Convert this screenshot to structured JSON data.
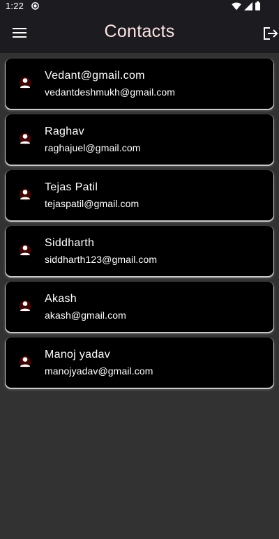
{
  "status_bar": {
    "time": "1:22",
    "icons": [
      "sync-circle-icon",
      "wifi-icon",
      "signal-icon",
      "battery-icon"
    ]
  },
  "app_bar": {
    "title": "Contacts",
    "left_icon": "menu-icon",
    "right_icon": "logout-icon"
  },
  "colors": {
    "background": "#323233",
    "app_bar": "#1c1b1f",
    "title": "#fde4e4",
    "card": "#000000",
    "avatar_glow": "#8b0a0a"
  },
  "contacts": [
    {
      "name": "Vedant@gmail.com",
      "email": "vedantdeshmukh@gmail.com",
      "icon": "person-icon"
    },
    {
      "name": "Raghav",
      "email": "raghajuel@gmail.com",
      "icon": "person-icon"
    },
    {
      "name": "Tejas Patil",
      "email": "tejaspatil@gmail.com",
      "icon": "person-icon"
    },
    {
      "name": "Siddharth",
      "email": "siddharth123@gmail.com",
      "icon": "person-icon"
    },
    {
      "name": "Akash",
      "email": "akash@gmail.com",
      "icon": "person-icon"
    },
    {
      "name": "Manoj yadav",
      "email": "manojyadav@gmail.com",
      "icon": "person-icon"
    }
  ]
}
